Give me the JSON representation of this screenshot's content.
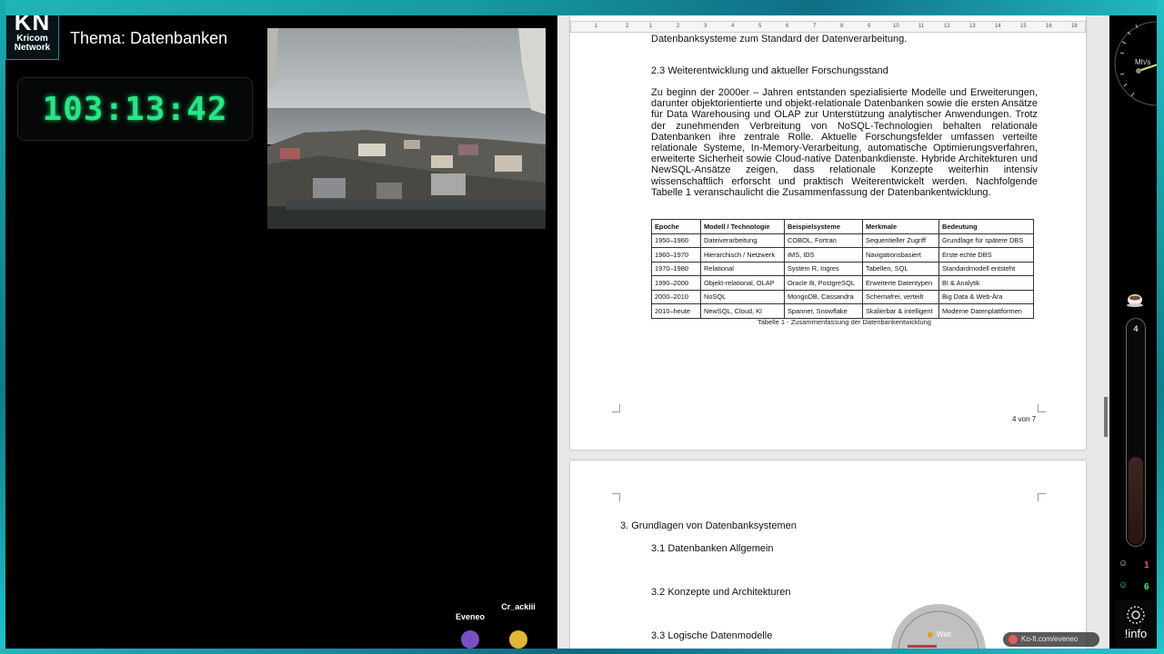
{
  "stream": {
    "logo_top": "KN",
    "logo_line1": "Kricom",
    "logo_line2": "Network",
    "topic": "Thema: Datenbanken",
    "timer": "103:13:42",
    "users": [
      {
        "name": "Eveneo",
        "color": "#7a4fc4"
      },
      {
        "name": "Cr_ackiii",
        "color": "#e2b534"
      }
    ]
  },
  "document": {
    "ruler_numbers": [
      "1",
      "2",
      "1",
      "2",
      "3",
      "4",
      "5",
      "6",
      "7",
      "8",
      "9",
      "10",
      "11",
      "12",
      "13",
      "14",
      "15",
      "16",
      "18"
    ],
    "page1": {
      "top_line": "Datenbanksysteme zum Standard der Datenverarbeitung.",
      "heading": "2.3 Weiterentwicklung und aktueller Forschungsstand",
      "paragraph": "Zu beginn der 2000er – Jahren entstanden spezialisierte Modelle und Erweiterungen, darunter objektorientierte und objekt-relationale Datenbanken sowie die ersten Ansätze für Data Warehousing und OLAP zur Unterstützung analytischer Anwendungen. Trotz der zunehmenden Verbreitung von NoSQL-Technologien behalten relationale Datenbanken ihre zentrale Rolle. Aktuelle Forschungsfelder umfassen verteilte relationale Systeme, In-Memory-Verarbeitung, automatische Optimierungsverfahren, erweiterte Sicherheit sowie Cloud-native Datenbankdienste. Hybride Architekturen und NewSQL-Ansätze zeigen, dass relationale Konzepte weiterhin intensiv wissenschaftlich erforscht und praktisch Weiterentwickelt werden. Nachfolgende Tabelle 1 veranschaulicht die Zusammenfassung der Datenbankentwicklung.",
      "table": {
        "headers": [
          "Epoche",
          "Modell / Technologie",
          "Beispielsysteme",
          "Merkmale",
          "Bedeutung"
        ],
        "rows": [
          [
            "1950–1960",
            "Dateiverarbeitung",
            "COBOL, Fortran",
            "Sequentieller Zugriff",
            "Grundlage für spätere DBS"
          ],
          [
            "1960–1970",
            "Hierarchisch / Netzwerk",
            "IMS, IDS",
            "Navigationsbasiert",
            "Erste echte DBS"
          ],
          [
            "1970–1980",
            "Relational",
            "System R, Ingres",
            "Tabellen, SQL",
            "Standardmodell entsteht"
          ],
          [
            "1990–2000",
            "Objekt-relational, OLAP",
            "Oracle 8i, PostgreSQL",
            "Erweiterte Datentypen",
            "BI & Analytik"
          ],
          [
            "2000–2010",
            "NoSQL",
            "MongoDB, Cassandra",
            "Schemafrei, verteilt",
            "Big Data & Web-Ära"
          ],
          [
            "2010–heute",
            "NewSQL, Cloud, KI",
            "Spanner, Snowflake",
            "Skalierbar & intelligent",
            "Moderne Datenplattformen"
          ]
        ]
      },
      "caption": "Tabelle 1 - Zusammenfassung der Datenbankentwicklung",
      "page_number": "4 von 7"
    },
    "page2": {
      "chapter": "3. Grundlagen von Datenbanksystemen",
      "sections": [
        "3.1 Datenbanken Allgemein",
        "3.2 Konzepte und Architekturen",
        "3.3 Logische Datenmodelle"
      ]
    }
  },
  "widgets": {
    "speed_unit": "Mh/s",
    "thermo_value": "4",
    "stat1_value": "1",
    "stat2_value": "6",
    "info_label": "!info",
    "kofi_text": "Ko-fi.com/eveneo",
    "gauge_label": "Watt"
  }
}
